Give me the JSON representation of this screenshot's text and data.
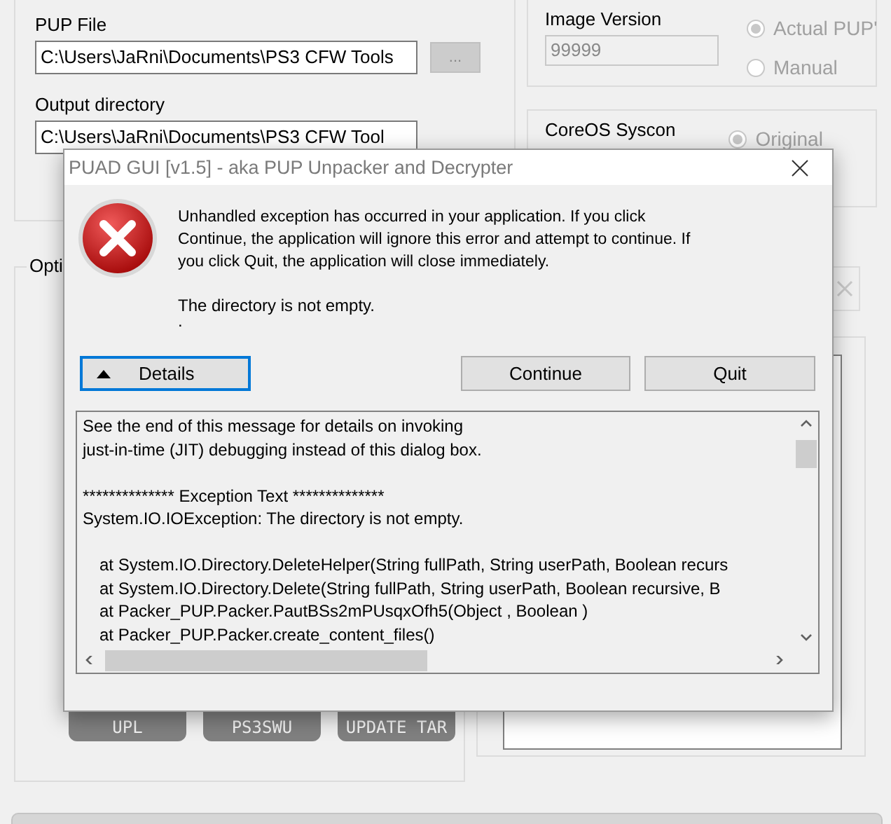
{
  "main_window": {
    "pup_file": {
      "label": "PUP File",
      "value": "C:\\Users\\JaRni\\Documents\\PS3 CFW Tools",
      "browse_label": "..."
    },
    "output_directory": {
      "label": "Output directory",
      "value": "C:\\Users\\JaRni\\Documents\\PS3 CFW Tool"
    },
    "image_version": {
      "label": "Image Version",
      "value": "99999",
      "options": [
        {
          "label": "Actual PUP'",
          "selected": true
        },
        {
          "label": "Manual",
          "selected": false
        }
      ]
    },
    "coreos_syscon": {
      "label": "CoreOS Syscon",
      "options": [
        {
          "label": "Original",
          "selected": true
        }
      ]
    },
    "options_group": {
      "label": "Opti",
      "buttons": [
        "UPL",
        "PS3SWU",
        "UPDATE TAR"
      ]
    }
  },
  "dialog": {
    "title": "PUAD GUI [v1.5] - aka PUP Unpacker and Decrypter",
    "message": "Unhandled exception has occurred in your application. If you click Continue, the application will ignore this error and attempt to continue. If you click Quit, the application will close immediately.",
    "error": "The directory is not empty.",
    "error_suffix": ".",
    "details_button": {
      "label": "Details",
      "expanded": true
    },
    "buttons": [
      "Continue",
      "Quit"
    ],
    "details_lines": [
      {
        "kind": "text",
        "text": "See the end of this message for details on invoking",
        "spaced": false
      },
      {
        "kind": "text",
        "text": "just-in-time (JIT) debugging instead of this dialog box.",
        "spaced": false
      },
      {
        "kind": "text",
        "text": "************** Exception Text **************",
        "spaced": true
      },
      {
        "kind": "text",
        "text": "System.IO.IOException: The directory is not empty.",
        "spaced": false
      },
      {
        "kind": "frame",
        "text": "at System.IO.Directory.DeleteHelper(String fullPath, String userPath, Boolean recurs",
        "spaced": true
      },
      {
        "kind": "frame",
        "text": "at System.IO.Directory.Delete(String fullPath, String userPath, Boolean recursive, B",
        "spaced": false
      },
      {
        "kind": "frame",
        "text": "at Packer_PUP.Packer.PautBSs2mPUsqxOfh5(Object , Boolean )",
        "spaced": false
      },
      {
        "kind": "frame",
        "text": "at Packer_PUP.Packer.create_content_files()",
        "spaced": false
      }
    ]
  }
}
